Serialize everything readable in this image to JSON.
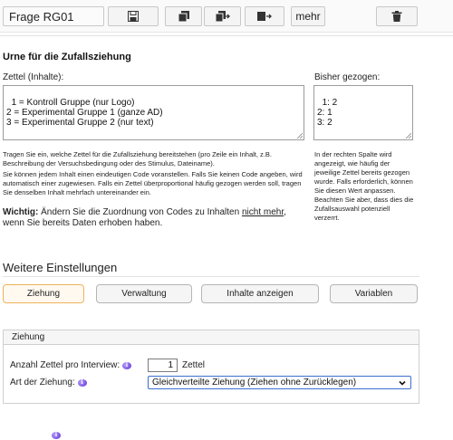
{
  "toolbar": {
    "question_name": "Frage RG01",
    "more_label": "mehr",
    "icons": [
      "save-icon",
      "copy-icon",
      "copy-forward-icon",
      "move-forward-icon",
      "trash-icon"
    ]
  },
  "urn": {
    "heading": "Urne für die Zufallsziehung",
    "tickets_label": "Zettel (Inhalte):",
    "tickets_text": "1 = Kontroll Gruppe (nur Logo)\n2 = Experimental Gruppe 1 (ganze AD)\n3 = Experimental Gruppe 2 (nur text)",
    "drawn_label": "Bisher gezogen:",
    "drawn_text": "1: 2\n2: 1\n3: 2",
    "help_left_1": "Tragen Sie ein, welche Zettel für die Zufallsziehung bereitstehen (pro Zeile ein Inhalt, z.B. Beschreibung der Versuchsbedingung oder des Stimulus, Dateiname).",
    "help_left_2": "Sie können jedem Inhalt einen eindeutigen Code voranstellen. Falls Sie keinen Code angeben, wird automatisch einer zugewiesen. Falls ein Zettel überproportional häufig gezogen werden soll, tragen Sie denselben Inhalt mehrfach untereinander ein.",
    "help_right": "In der rechten Spalte wird angezeigt, wie häufig der jeweilige Zettel bereits gezogen wurde. Falls erforderlich, können Sie diesen Wert anpassen. Beachten Sie aber, dass dies die Zufallsauswahl potenziell verzerrt.",
    "warning_bold": "Wichtig:",
    "warning_pre": " Ändern Sie die Zuordnung von Codes zu Inhalten ",
    "warning_underlined": "nicht mehr",
    "warning_post": ", wenn Sie bereits Daten erhoben haben."
  },
  "settings": {
    "heading": "Weitere Einstellungen",
    "tabs": [
      "Ziehung",
      "Verwaltung",
      "Inhalte anzeigen",
      "Variablen"
    ],
    "active_tab": "Ziehung"
  },
  "ziehung": {
    "title": "Ziehung",
    "count_label": "Anzahl Zettel pro Interview:",
    "count_value": "1",
    "count_unit": "Zettel",
    "type_label": "Art der Ziehung:",
    "type_value": "Gleichverteilte Ziehung (Ziehen ohne Zurücklegen)"
  },
  "colors": {
    "active_tab_border": "#f0b25a",
    "select_border": "#3b6fd0",
    "info_icon": "#5b2bd0"
  }
}
